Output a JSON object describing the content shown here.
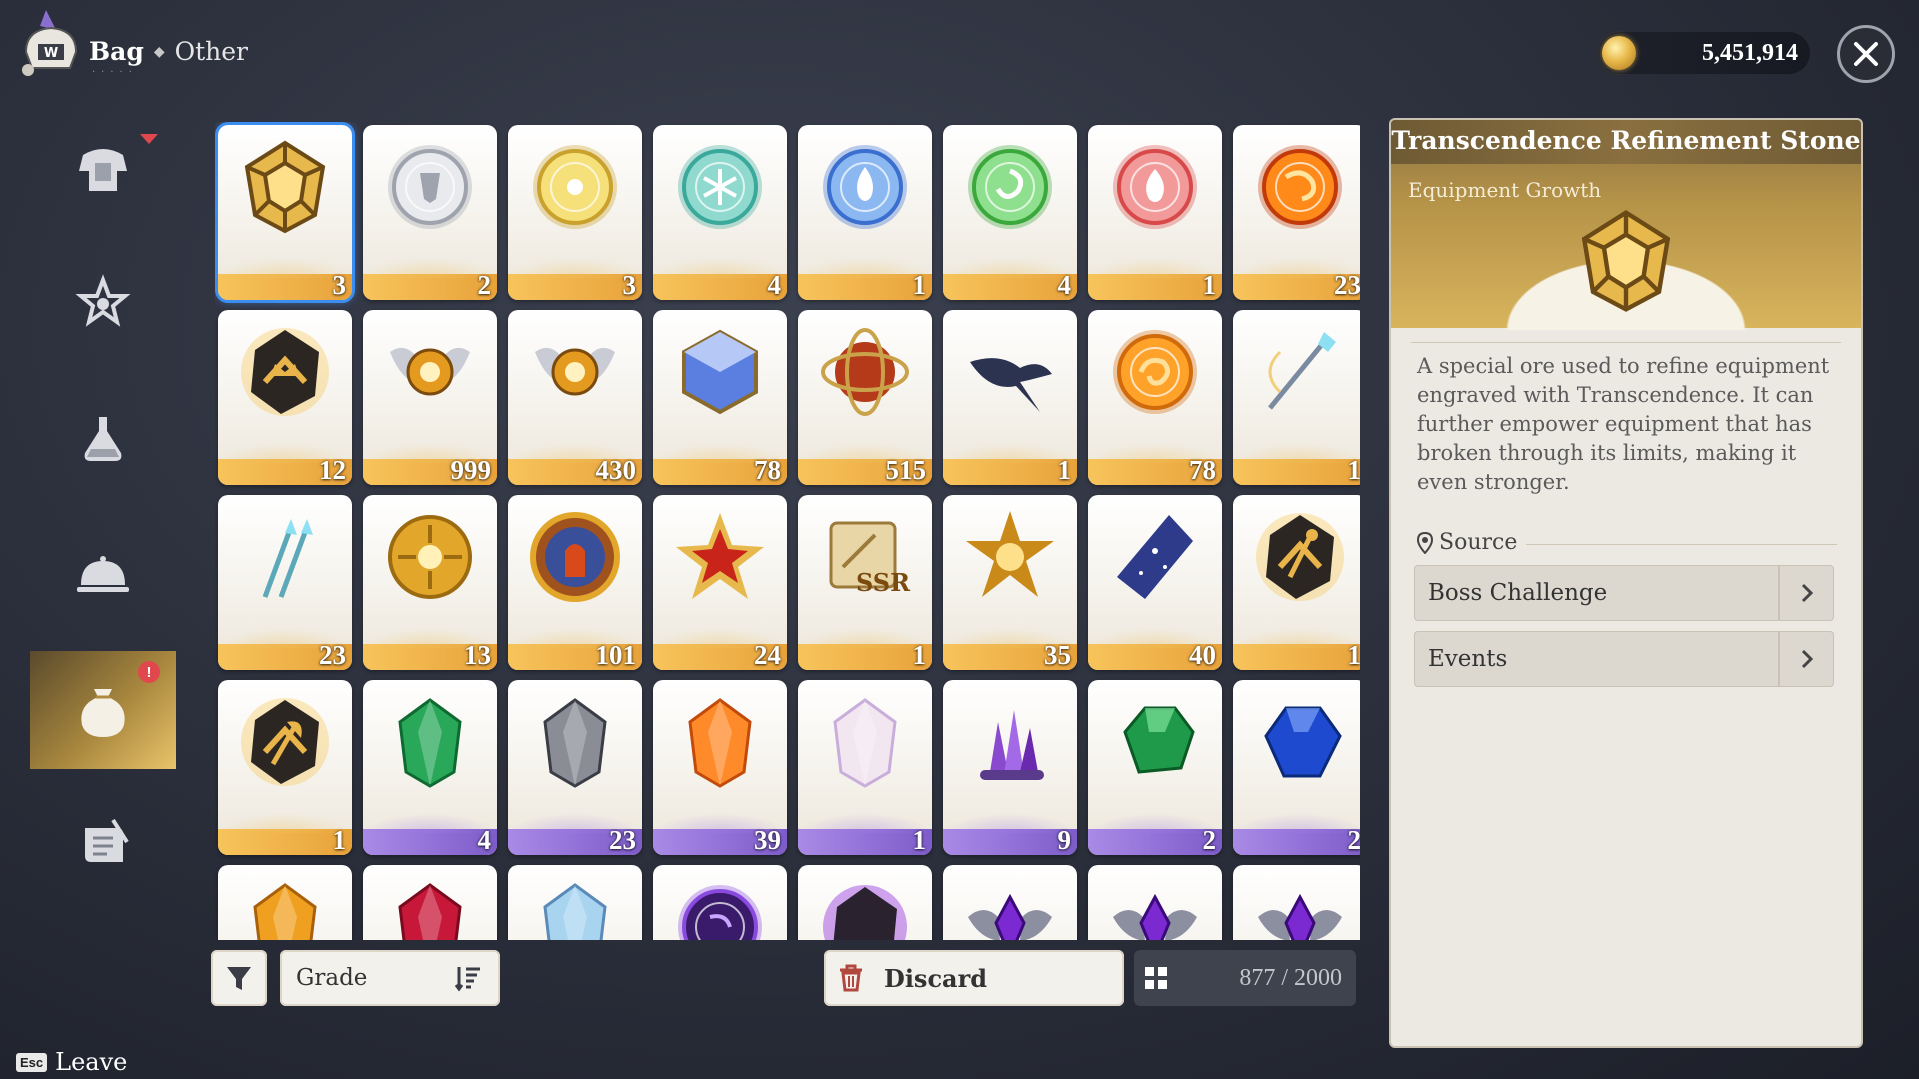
{
  "header": {
    "title": "Bag",
    "subtitle": "Other",
    "currency_amount": "5,451,914"
  },
  "nav": {
    "items": [
      {
        "name": "equipment",
        "active": false,
        "badge": "triangle"
      },
      {
        "name": "materials",
        "active": false,
        "badge": ""
      },
      {
        "name": "consumables",
        "active": false,
        "badge": ""
      },
      {
        "name": "food",
        "active": false,
        "badge": ""
      },
      {
        "name": "other",
        "active": true,
        "badge": "!"
      },
      {
        "name": "quest-items",
        "active": false,
        "badge": ""
      }
    ]
  },
  "grid": {
    "rows": [
      [
        {
          "icon": "golden-dodecahedron-stone-icon",
          "qty": "3",
          "grade": "gold",
          "selected": true
        },
        {
          "icon": "silver-crest-orb-icon",
          "qty": "2",
          "grade": "gold"
        },
        {
          "icon": "yellow-sun-orb-icon",
          "qty": "3",
          "grade": "gold"
        },
        {
          "icon": "teal-snowflake-orb-icon",
          "qty": "4",
          "grade": "gold"
        },
        {
          "icon": "blue-flame-orb-icon",
          "qty": "1",
          "grade": "gold"
        },
        {
          "icon": "green-swirl-orb-icon",
          "qty": "4",
          "grade": "gold"
        },
        {
          "icon": "red-fire-orb-icon",
          "qty": "1",
          "grade": "gold"
        },
        {
          "icon": "fire-swirl-orb-icon",
          "qty": "23",
          "grade": "gold"
        }
      ],
      [
        {
          "icon": "crown-rune-stone-icon",
          "qty": "12",
          "grade": "gold"
        },
        {
          "icon": "winged-gold-emblem-icon",
          "qty": "999",
          "grade": "gold"
        },
        {
          "icon": "winged-gold-emblem-icon",
          "qty": "430",
          "grade": "gold"
        },
        {
          "icon": "blue-crystal-cube-icon",
          "qty": "78",
          "grade": "gold"
        },
        {
          "icon": "armillary-sphere-icon",
          "qty": "515",
          "grade": "gold"
        },
        {
          "icon": "manta-ray-icon",
          "qty": "1",
          "grade": "gold"
        },
        {
          "icon": "orange-swirl-orb-icon",
          "qty": "78",
          "grade": "gold"
        },
        {
          "icon": "crystal-staff-icon",
          "qty": "1",
          "grade": "gold"
        }
      ],
      [
        {
          "icon": "twin-spears-icon",
          "qty": "23",
          "grade": "gold"
        },
        {
          "icon": "gold-sun-seal-icon",
          "qty": "13",
          "grade": "gold"
        },
        {
          "icon": "knight-medallion-icon",
          "qty": "101",
          "grade": "gold"
        },
        {
          "icon": "red-star-badge-icon",
          "qty": "24",
          "grade": "gold"
        },
        {
          "icon": "ssr-scroll-icon",
          "qty": "1",
          "grade": "gold"
        },
        {
          "icon": "gold-star-badge-icon",
          "qty": "35",
          "grade": "gold"
        },
        {
          "icon": "starry-crystal-shard-icon",
          "qty": "40",
          "grade": "gold"
        },
        {
          "icon": "staff-rune-stone-icon",
          "qty": "1",
          "grade": "gold"
        }
      ],
      [
        {
          "icon": "axe-rune-stone-icon",
          "qty": "1",
          "grade": "gold"
        },
        {
          "icon": "green-crystal-icon",
          "qty": "4",
          "grade": "purple"
        },
        {
          "icon": "grey-ore-icon",
          "qty": "23",
          "grade": "purple"
        },
        {
          "icon": "orange-crystal-icon",
          "qty": "39",
          "grade": "purple"
        },
        {
          "icon": "opal-crystal-icon",
          "qty": "1",
          "grade": "purple"
        },
        {
          "icon": "amethyst-cluster-icon",
          "qty": "9",
          "grade": "purple"
        },
        {
          "icon": "emerald-gem-icon",
          "qty": "2",
          "grade": "purple"
        },
        {
          "icon": "sapphire-gem-icon",
          "qty": "2",
          "grade": "purple"
        }
      ],
      [
        {
          "icon": "amber-ore-icon",
          "qty": "",
          "grade": "gold"
        },
        {
          "icon": "ruby-gem-icon",
          "qty": "",
          "grade": "gold"
        },
        {
          "icon": "ice-ore-icon",
          "qty": "",
          "grade": "gold"
        },
        {
          "icon": "dark-purple-orb-icon",
          "qty": "",
          "grade": "gold"
        },
        {
          "icon": "purple-rune-stone-icon",
          "qty": "",
          "grade": "gold"
        },
        {
          "icon": "winged-purple-emblem-icon",
          "qty": "",
          "grade": "gold"
        },
        {
          "icon": "winged-purple-emblem-icon",
          "qty": "",
          "grade": "gold"
        },
        {
          "icon": "winged-purple-emblem-icon",
          "qty": "",
          "grade": "gold"
        }
      ]
    ]
  },
  "toolbar": {
    "sort_label": "Grade",
    "discard_label": "Discard",
    "capacity": "877 / 2000",
    "leave_key": "Esc",
    "leave_label": "Leave"
  },
  "detail": {
    "title": "Transcendence Refinement Stone",
    "category": "Equipment Growth",
    "description": "A special ore used to refine equipment engraved with Transcendence. It can further empower equipment that has broken through its limits, making it even stronger.",
    "source_heading": "Source",
    "sources": [
      "Boss Challenge",
      "Events"
    ]
  },
  "colors": {
    "selected_outline": "#3b8ef0",
    "gold_band": "#f2b74f",
    "purple_band": "#8e6ed6",
    "badge_red": "#e0484d",
    "panel_bg": "#ece9e3",
    "header_gold": "#b59348"
  }
}
